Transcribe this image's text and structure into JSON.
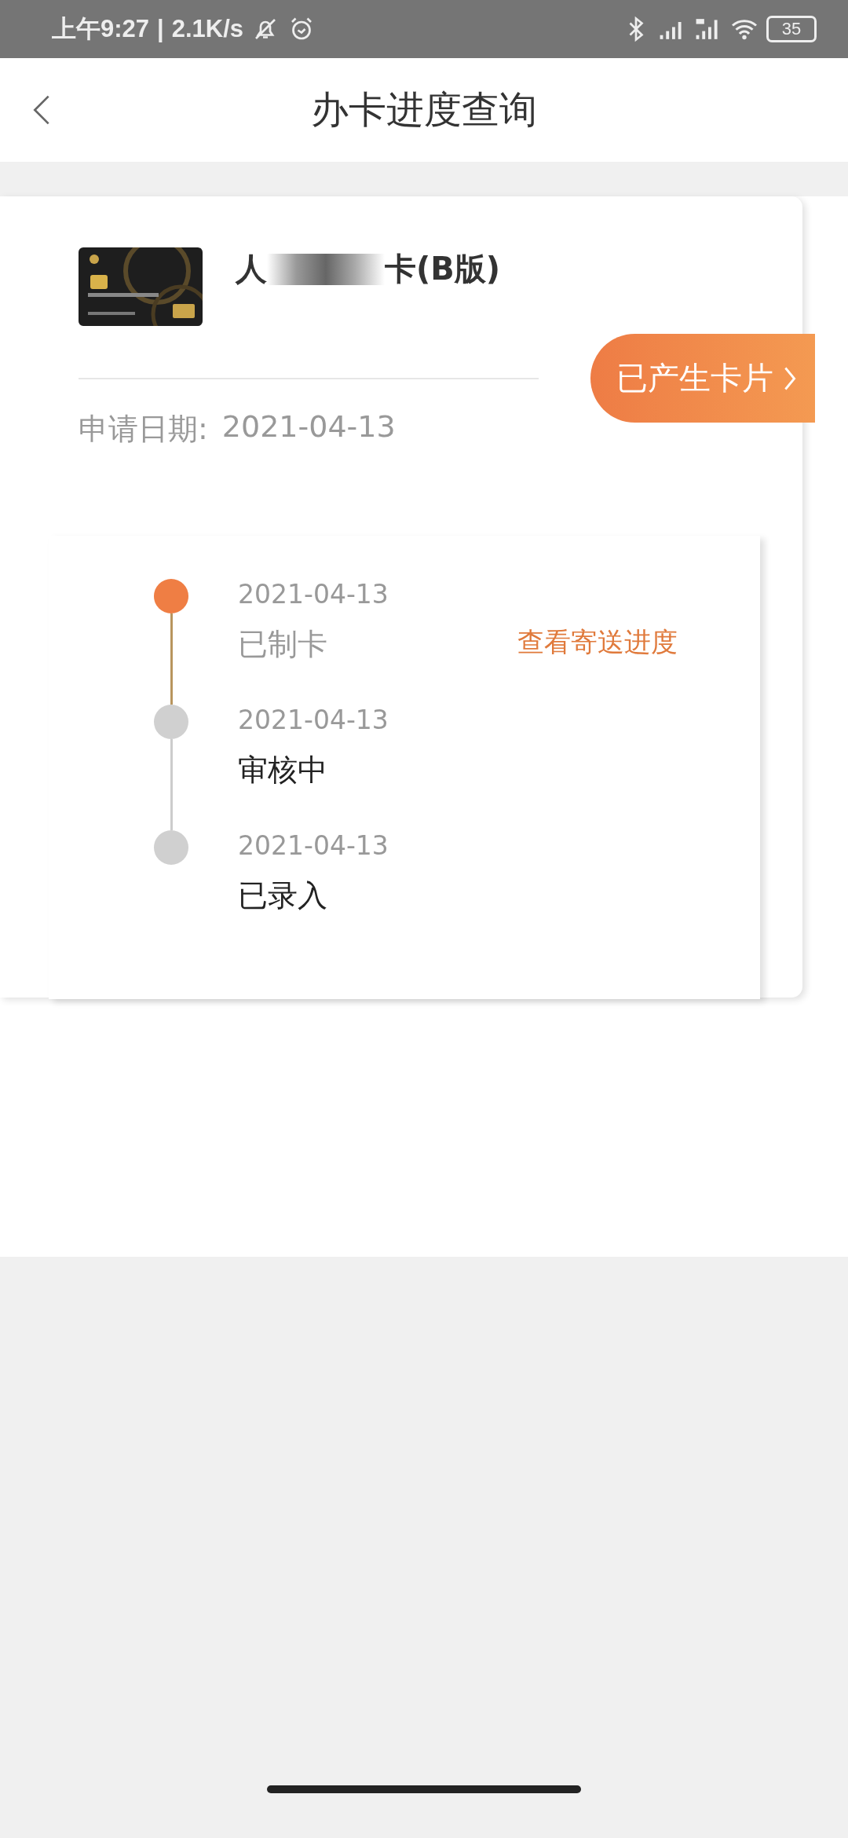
{
  "status_bar": {
    "time": "上午9:27",
    "separator": "|",
    "speed": "2.1K/s",
    "battery": "35"
  },
  "header": {
    "title": "办卡进度查询"
  },
  "card": {
    "name_parts": [
      "人",
      "卡(B版)"
    ],
    "badge": "已产生卡片",
    "date_label": "申请日期:",
    "date": "2021-04-13"
  },
  "timeline": [
    {
      "date": "2021-04-13",
      "status": "已制卡",
      "active": true,
      "action": "查看寄送进度"
    },
    {
      "date": "2021-04-13",
      "status": "审核中",
      "active": false
    },
    {
      "date": "2021-04-13",
      "status": "已录入",
      "active": false
    }
  ]
}
